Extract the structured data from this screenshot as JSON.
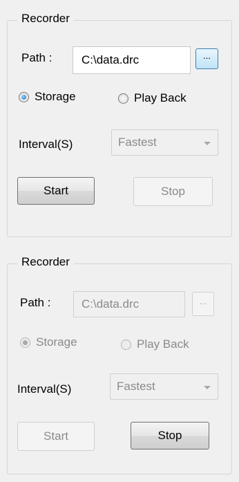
{
  "panels": [
    {
      "title": "Recorder",
      "path_label": "Path :",
      "path_value": "C:\\data.drc",
      "browse_label": "...",
      "radio_storage": "Storage",
      "radio_playback": "Play Back",
      "selected_mode": "Storage",
      "interval_label": "Interval(S)",
      "interval_value": "Fastest",
      "start_label": "Start",
      "stop_label": "Stop",
      "state": "idle"
    },
    {
      "title": "Recorder",
      "path_label": "Path :",
      "path_value": "C:\\data.drc",
      "browse_label": "...",
      "radio_storage": "Storage",
      "radio_playback": "Play Back",
      "selected_mode": "Storage",
      "interval_label": "Interval(S)",
      "interval_value": "Fastest",
      "start_label": "Start",
      "stop_label": "Stop",
      "state": "recording"
    }
  ],
  "colors": {
    "window_bg": "#f0f0f0",
    "radio_accent": "#1f6fb8",
    "browse_active": "#bfe3f6"
  }
}
